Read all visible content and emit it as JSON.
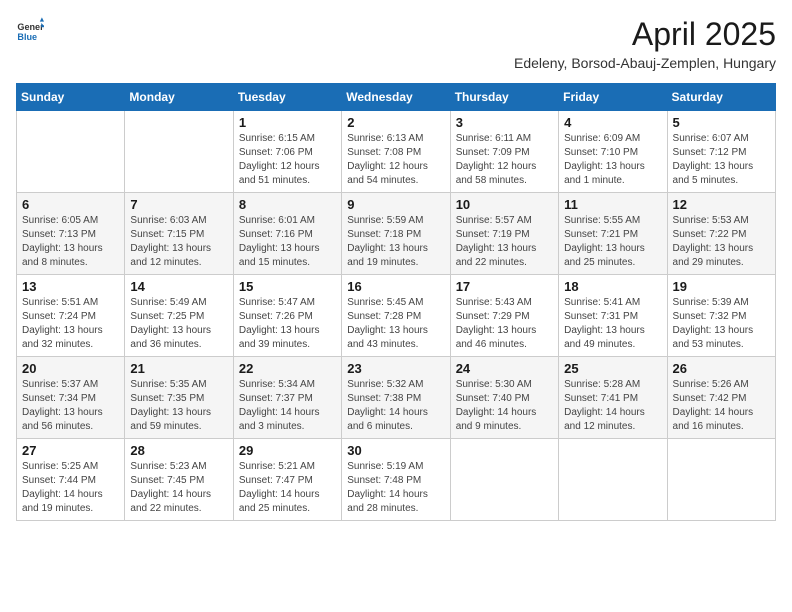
{
  "header": {
    "logo_general": "General",
    "logo_blue": "Blue",
    "month_year": "April 2025",
    "location": "Edeleny, Borsod-Abauj-Zemplen, Hungary"
  },
  "days_of_week": [
    "Sunday",
    "Monday",
    "Tuesday",
    "Wednesday",
    "Thursday",
    "Friday",
    "Saturday"
  ],
  "weeks": [
    [
      {
        "day": "",
        "info": ""
      },
      {
        "day": "",
        "info": ""
      },
      {
        "day": "1",
        "info": "Sunrise: 6:15 AM\nSunset: 7:06 PM\nDaylight: 12 hours\nand 51 minutes."
      },
      {
        "day": "2",
        "info": "Sunrise: 6:13 AM\nSunset: 7:08 PM\nDaylight: 12 hours\nand 54 minutes."
      },
      {
        "day": "3",
        "info": "Sunrise: 6:11 AM\nSunset: 7:09 PM\nDaylight: 12 hours\nand 58 minutes."
      },
      {
        "day": "4",
        "info": "Sunrise: 6:09 AM\nSunset: 7:10 PM\nDaylight: 13 hours\nand 1 minute."
      },
      {
        "day": "5",
        "info": "Sunrise: 6:07 AM\nSunset: 7:12 PM\nDaylight: 13 hours\nand 5 minutes."
      }
    ],
    [
      {
        "day": "6",
        "info": "Sunrise: 6:05 AM\nSunset: 7:13 PM\nDaylight: 13 hours\nand 8 minutes."
      },
      {
        "day": "7",
        "info": "Sunrise: 6:03 AM\nSunset: 7:15 PM\nDaylight: 13 hours\nand 12 minutes."
      },
      {
        "day": "8",
        "info": "Sunrise: 6:01 AM\nSunset: 7:16 PM\nDaylight: 13 hours\nand 15 minutes."
      },
      {
        "day": "9",
        "info": "Sunrise: 5:59 AM\nSunset: 7:18 PM\nDaylight: 13 hours\nand 19 minutes."
      },
      {
        "day": "10",
        "info": "Sunrise: 5:57 AM\nSunset: 7:19 PM\nDaylight: 13 hours\nand 22 minutes."
      },
      {
        "day": "11",
        "info": "Sunrise: 5:55 AM\nSunset: 7:21 PM\nDaylight: 13 hours\nand 25 minutes."
      },
      {
        "day": "12",
        "info": "Sunrise: 5:53 AM\nSunset: 7:22 PM\nDaylight: 13 hours\nand 29 minutes."
      }
    ],
    [
      {
        "day": "13",
        "info": "Sunrise: 5:51 AM\nSunset: 7:24 PM\nDaylight: 13 hours\nand 32 minutes."
      },
      {
        "day": "14",
        "info": "Sunrise: 5:49 AM\nSunset: 7:25 PM\nDaylight: 13 hours\nand 36 minutes."
      },
      {
        "day": "15",
        "info": "Sunrise: 5:47 AM\nSunset: 7:26 PM\nDaylight: 13 hours\nand 39 minutes."
      },
      {
        "day": "16",
        "info": "Sunrise: 5:45 AM\nSunset: 7:28 PM\nDaylight: 13 hours\nand 43 minutes."
      },
      {
        "day": "17",
        "info": "Sunrise: 5:43 AM\nSunset: 7:29 PM\nDaylight: 13 hours\nand 46 minutes."
      },
      {
        "day": "18",
        "info": "Sunrise: 5:41 AM\nSunset: 7:31 PM\nDaylight: 13 hours\nand 49 minutes."
      },
      {
        "day": "19",
        "info": "Sunrise: 5:39 AM\nSunset: 7:32 PM\nDaylight: 13 hours\nand 53 minutes."
      }
    ],
    [
      {
        "day": "20",
        "info": "Sunrise: 5:37 AM\nSunset: 7:34 PM\nDaylight: 13 hours\nand 56 minutes."
      },
      {
        "day": "21",
        "info": "Sunrise: 5:35 AM\nSunset: 7:35 PM\nDaylight: 13 hours\nand 59 minutes."
      },
      {
        "day": "22",
        "info": "Sunrise: 5:34 AM\nSunset: 7:37 PM\nDaylight: 14 hours\nand 3 minutes."
      },
      {
        "day": "23",
        "info": "Sunrise: 5:32 AM\nSunset: 7:38 PM\nDaylight: 14 hours\nand 6 minutes."
      },
      {
        "day": "24",
        "info": "Sunrise: 5:30 AM\nSunset: 7:40 PM\nDaylight: 14 hours\nand 9 minutes."
      },
      {
        "day": "25",
        "info": "Sunrise: 5:28 AM\nSunset: 7:41 PM\nDaylight: 14 hours\nand 12 minutes."
      },
      {
        "day": "26",
        "info": "Sunrise: 5:26 AM\nSunset: 7:42 PM\nDaylight: 14 hours\nand 16 minutes."
      }
    ],
    [
      {
        "day": "27",
        "info": "Sunrise: 5:25 AM\nSunset: 7:44 PM\nDaylight: 14 hours\nand 19 minutes."
      },
      {
        "day": "28",
        "info": "Sunrise: 5:23 AM\nSunset: 7:45 PM\nDaylight: 14 hours\nand 22 minutes."
      },
      {
        "day": "29",
        "info": "Sunrise: 5:21 AM\nSunset: 7:47 PM\nDaylight: 14 hours\nand 25 minutes."
      },
      {
        "day": "30",
        "info": "Sunrise: 5:19 AM\nSunset: 7:48 PM\nDaylight: 14 hours\nand 28 minutes."
      },
      {
        "day": "",
        "info": ""
      },
      {
        "day": "",
        "info": ""
      },
      {
        "day": "",
        "info": ""
      }
    ]
  ]
}
